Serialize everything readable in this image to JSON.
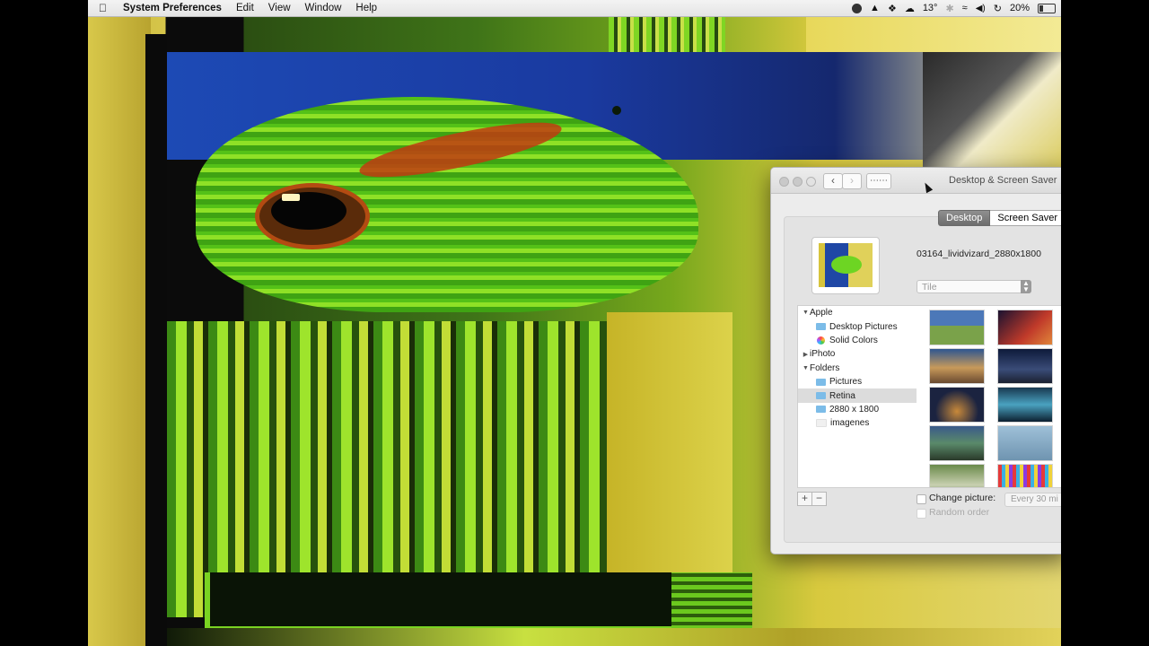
{
  "menubar": {
    "apple_icon": "apple-icon",
    "app_name": "System Preferences",
    "menus": [
      "Edit",
      "View",
      "Window",
      "Help"
    ],
    "status": {
      "weather": "13°",
      "battery": "20%"
    }
  },
  "window": {
    "title": "Desktop & Screen Saver",
    "tabs": [
      "Desktop",
      "Screen Saver"
    ],
    "selected_tab": "Desktop",
    "current_picture": "03164_lividvizard_2880x1800",
    "fit_option": "Tile",
    "sidebar": [
      {
        "label": "Apple",
        "kind": "group",
        "expanded": true
      },
      {
        "label": "Desktop Pictures",
        "kind": "folder"
      },
      {
        "label": "Solid Colors",
        "kind": "colors"
      },
      {
        "label": "iPhoto",
        "kind": "group",
        "expanded": false
      },
      {
        "label": "Folders",
        "kind": "group",
        "expanded": true
      },
      {
        "label": "Pictures",
        "kind": "folder"
      },
      {
        "label": "Retina",
        "kind": "folder",
        "selected": true
      },
      {
        "label": "2880 x 1800",
        "kind": "folder"
      },
      {
        "label": "imagenes",
        "kind": "folder-empty"
      }
    ],
    "change_picture_label": "Change picture:",
    "interval": "Every 30 mi",
    "random_order_label": "Random order",
    "add_button": "+",
    "remove_button": "−"
  }
}
